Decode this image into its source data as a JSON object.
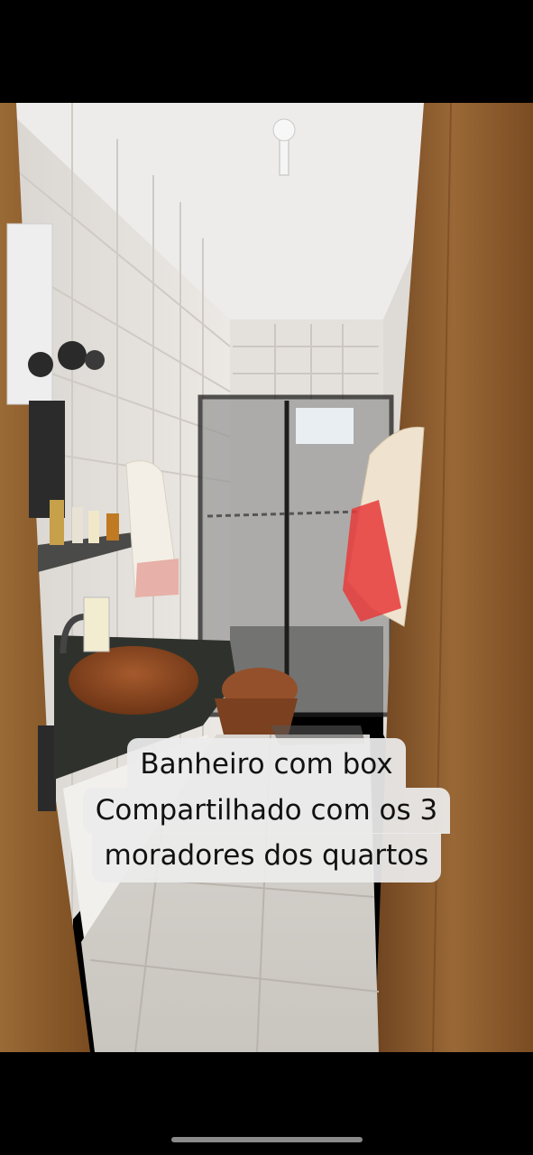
{
  "photo": {
    "description_icon": "bathroom-photo"
  },
  "caption": {
    "line1": "Banheiro com box",
    "line2": "Compartilhado com os 3",
    "line3": "moradores dos quartos"
  },
  "colors": {
    "background": "#000000",
    "caption_bg": "#ececec",
    "caption_text": "#111111",
    "door_wood": "#8a5a2b",
    "sink_bowl": "#8a4a25",
    "tile": "#e9e6e2"
  }
}
